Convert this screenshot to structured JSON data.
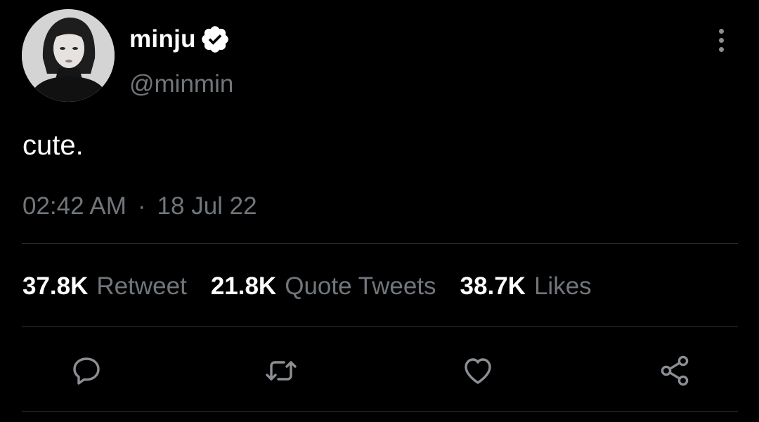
{
  "user": {
    "display_name": "minju",
    "handle": "@minmin",
    "verified": true,
    "avatar_icon": "profile-photo"
  },
  "tweet": {
    "text": "cute.",
    "time": "02:42 AM",
    "separator": "·",
    "date": "18 Jul 22"
  },
  "stats": {
    "retweets_count": "37.8K",
    "retweets_label": "Retweet",
    "quotes_count": "21.8K",
    "quotes_label": "Quote Tweets",
    "likes_count": "38.7K",
    "likes_label": "Likes"
  },
  "actions": {
    "reply_icon": "speech-bubble-icon",
    "retweet_icon": "retweet-arrows-icon",
    "like_icon": "heart-icon",
    "share_icon": "share-nodes-icon",
    "more_icon": "vertical-ellipsis-icon"
  },
  "colors": {
    "background": "#000000",
    "primary_text": "#ffffff",
    "secondary_text": "#71767b",
    "divider": "#2f3336",
    "icon": "#8b8f93"
  }
}
